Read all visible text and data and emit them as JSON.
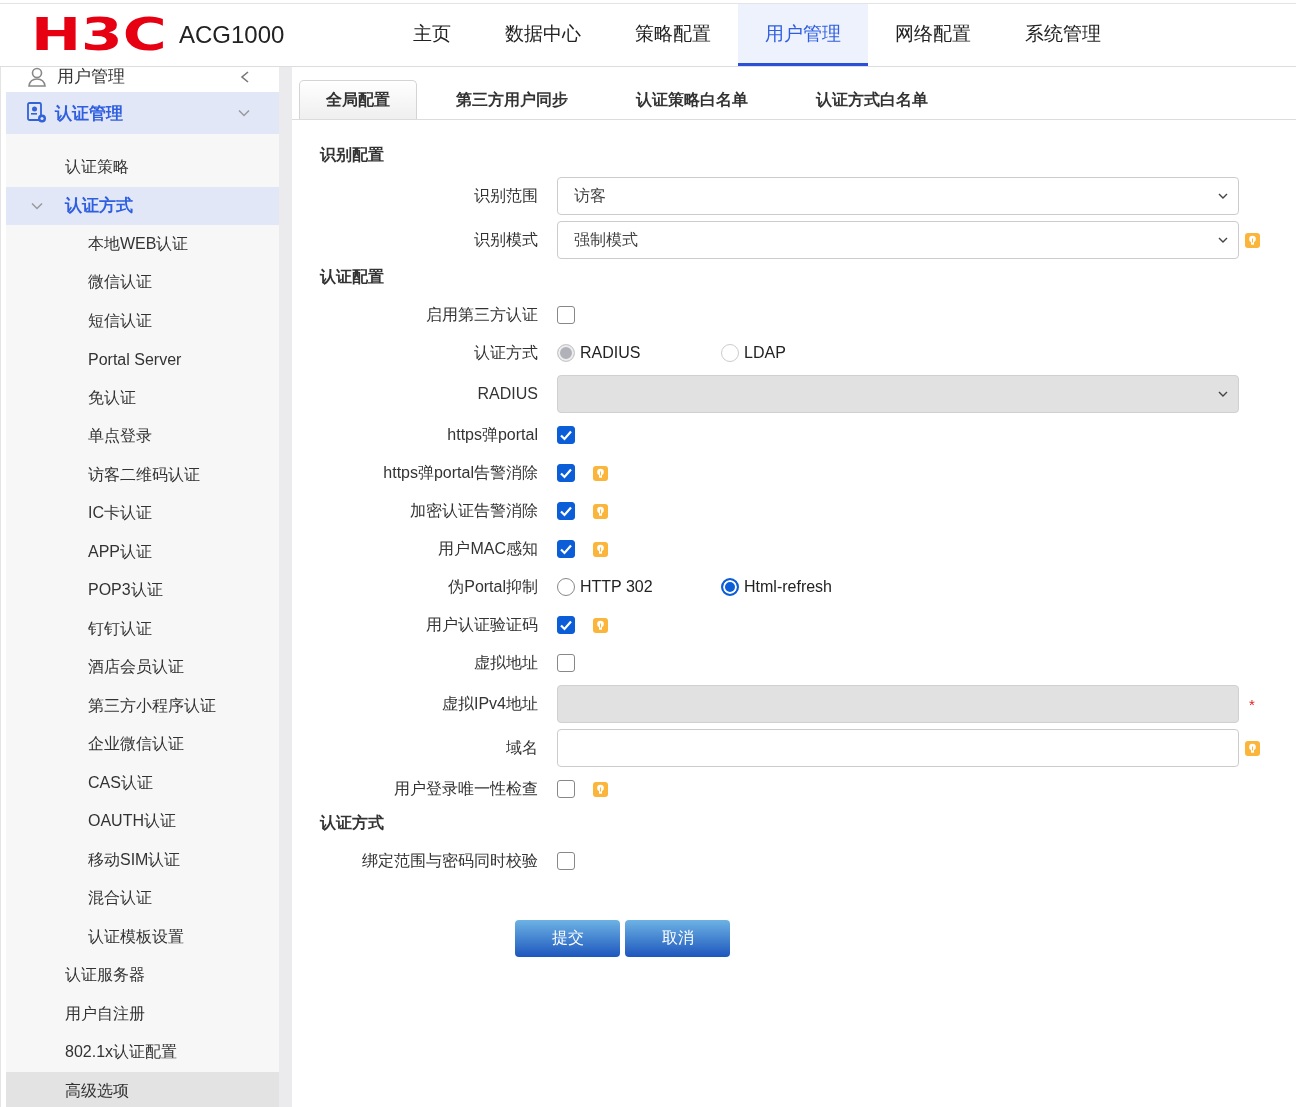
{
  "header": {
    "logo": "H3C",
    "product": "ACG1000",
    "nav": [
      {
        "label": "主页",
        "selected": false
      },
      {
        "label": "数据中心",
        "selected": false
      },
      {
        "label": "策略配置",
        "selected": false
      },
      {
        "label": "用户管理",
        "selected": true
      },
      {
        "label": "网络配置",
        "selected": false
      },
      {
        "label": "系统管理",
        "selected": false
      }
    ]
  },
  "sidebar": {
    "module": {
      "label": "用户管理"
    },
    "items": [
      {
        "label": "认证管理",
        "expanded": true,
        "children": [
          {
            "label": "认证策略",
            "selected": false,
            "hovered": false
          },
          {
            "label": "认证方式",
            "selected": true,
            "hovered": false,
            "expanded": true,
            "children": [
              {
                "label": "本地WEB认证"
              },
              {
                "label": "微信认证"
              },
              {
                "label": "短信认证"
              },
              {
                "label": "Portal Server"
              },
              {
                "label": "免认证"
              },
              {
                "label": "单点登录"
              },
              {
                "label": "访客二维码认证"
              },
              {
                "label": "IC卡认证"
              },
              {
                "label": "APP认证"
              },
              {
                "label": "POP3认证"
              },
              {
                "label": "钉钉认证"
              },
              {
                "label": "酒店会员认证"
              },
              {
                "label": "第三方小程序认证"
              },
              {
                "label": "企业微信认证"
              },
              {
                "label": "CAS认证"
              },
              {
                "label": "OAUTH认证"
              },
              {
                "label": "移动SIM认证"
              },
              {
                "label": "混合认证"
              },
              {
                "label": "认证模板设置"
              }
            ]
          },
          {
            "label": "认证服务器",
            "selected": false,
            "hovered": false
          },
          {
            "label": "用户自注册",
            "selected": false,
            "hovered": false
          },
          {
            "label": "802.1x认证配置",
            "selected": false,
            "hovered": false
          },
          {
            "label": "高级选项",
            "selected": false,
            "hovered": true
          }
        ]
      }
    ]
  },
  "tabs": [
    {
      "label": "全局配置",
      "selected": true
    },
    {
      "label": "第三方用户同步",
      "selected": false
    },
    {
      "label": "认证策略白名单",
      "selected": false
    },
    {
      "label": "认证方式白名单",
      "selected": false
    }
  ],
  "form": {
    "sections": [
      {
        "title": "识别配置",
        "rows": [
          {
            "kind": "select",
            "label": "识别范围",
            "value": "访客",
            "disabled": false,
            "hint": false
          },
          {
            "kind": "select",
            "label": "识别模式",
            "value": "强制模式",
            "disabled": false,
            "hint": true
          }
        ]
      },
      {
        "title": "认证配置",
        "rows": [
          {
            "kind": "checkbox",
            "label": "启用第三方认证",
            "checked": false,
            "hint": false
          },
          {
            "kind": "radio",
            "label": "认证方式",
            "disabled": true,
            "options": [
              {
                "label": "RADIUS",
                "selected": true
              },
              {
                "label": "LDAP",
                "selected": false
              }
            ]
          },
          {
            "kind": "select",
            "label": "RADIUS",
            "disabled": true,
            "hint": false
          },
          {
            "kind": "checkbox",
            "label": "https弹portal",
            "checked": true,
            "hint": false
          },
          {
            "kind": "checkbox",
            "label": "https弹portal告警消除",
            "checked": true,
            "hint": true
          },
          {
            "kind": "checkbox",
            "label": "加密认证告警消除",
            "checked": true,
            "hint": true
          },
          {
            "kind": "checkbox",
            "label": "用户MAC感知",
            "checked": true,
            "hint": true
          },
          {
            "kind": "radio",
            "label": "伪Portal抑制",
            "disabled": false,
            "options": [
              {
                "label": "HTTP 302",
                "selected": false
              },
              {
                "label": "Html-refresh",
                "selected": true
              }
            ]
          },
          {
            "kind": "checkbox",
            "label": "用户认证验证码",
            "checked": true,
            "hint": true
          },
          {
            "kind": "checkbox",
            "label": "虚拟地址",
            "checked": false,
            "hint": false
          },
          {
            "kind": "text",
            "label": "虚拟IPv4地址",
            "disabled": true,
            "required_mark": "*",
            "hint": false
          },
          {
            "kind": "text",
            "label": "域名",
            "disabled": false,
            "hint": true
          },
          {
            "kind": "checkbox",
            "label": "用户登录唯一性检查",
            "checked": false,
            "hint": true
          }
        ]
      },
      {
        "title": "认证方式",
        "rows": [
          {
            "kind": "checkbox",
            "label": "绑定范围与密码同时校验",
            "checked": false,
            "hint": false
          }
        ]
      }
    ],
    "buttons": [
      "提交",
      "取消"
    ]
  }
}
